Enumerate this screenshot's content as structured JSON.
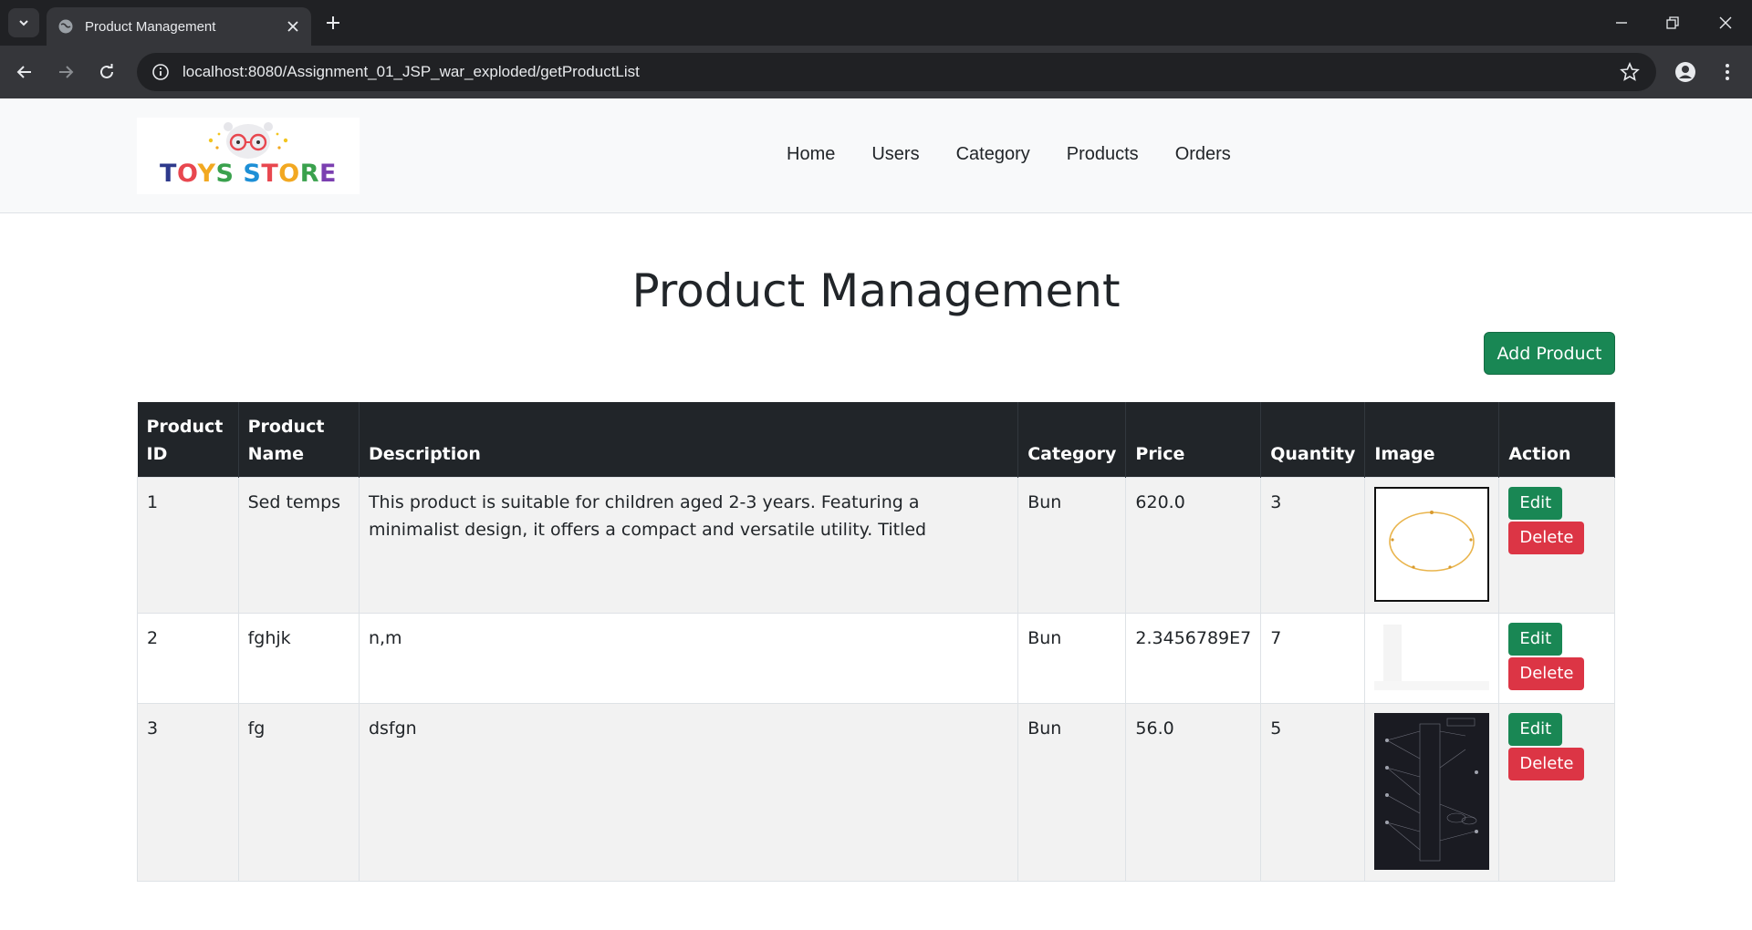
{
  "browser": {
    "tab_title": "Product Management",
    "url": "localhost:8080/Assignment_01_JSP_war_exploded/getProductList"
  },
  "site": {
    "logo_text": "TOYS STORE",
    "nav": [
      "Home",
      "Users",
      "Category",
      "Products",
      "Orders"
    ]
  },
  "page": {
    "title": "Product Management",
    "add_button": "Add Product"
  },
  "table": {
    "headers": [
      "Product ID",
      "Product Name",
      "Description",
      "Category",
      "Price",
      "Quantity",
      "Image",
      "Action"
    ],
    "rows": [
      {
        "id": "1",
        "name": "Sed temps",
        "description": "This product is suitable for children aged 2-3 years. Featuring a minimalist design, it offers a compact and versatile utility. Titled",
        "category": "Bun",
        "price": "620.0",
        "quantity": "3",
        "image": "necklace-thumbnail",
        "edit": "Edit",
        "delete": "Delete"
      },
      {
        "id": "2",
        "name": "fghjk",
        "description": "n,m",
        "category": "Bun",
        "price": "2.3456789E7",
        "quantity": "7",
        "image": "blank-thumbnail",
        "edit": "Edit",
        "delete": "Delete"
      },
      {
        "id": "3",
        "name": "fg",
        "description": "dsfgn",
        "category": "Bun",
        "price": "56.0",
        "quantity": "5",
        "image": "diagram-thumbnail",
        "edit": "Edit",
        "delete": "Delete"
      }
    ]
  },
  "colors": {
    "success": "#198754",
    "danger": "#dc3545",
    "table_header": "#212529",
    "striped_row": "#f2f2f2"
  }
}
